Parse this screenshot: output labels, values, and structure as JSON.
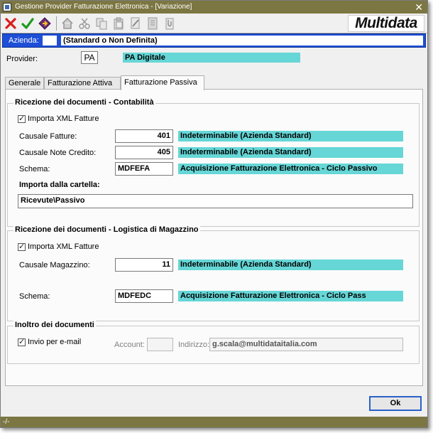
{
  "window": {
    "title": "Gestione Provider Fatturazione Elettronica - [Variazione]",
    "close_glyph": "✕"
  },
  "toolbar": {
    "logo_text": "Multidata",
    "buttons": [
      {
        "name": "cancel-icon"
      },
      {
        "name": "confirm-icon"
      },
      {
        "name": "run-icon"
      },
      {
        "name": "home-icon"
      },
      {
        "name": "cut-icon"
      },
      {
        "name": "copy-icon"
      },
      {
        "name": "paste-icon"
      },
      {
        "name": "edit-icon"
      },
      {
        "name": "document-icon"
      },
      {
        "name": "attach-icon"
      }
    ]
  },
  "azienda": {
    "label": "Azienda:",
    "code": "",
    "description": "(Standard o Non Definita)"
  },
  "provider": {
    "label": "Provider:",
    "code": "PA",
    "description": "PA Digitale"
  },
  "tabs": [
    {
      "label": "Generale",
      "active": false
    },
    {
      "label": "Fatturazione Attiva",
      "active": false
    },
    {
      "label": "Fatturazione Passiva",
      "active": true
    }
  ],
  "ricezione_contabilita": {
    "legend": "Ricezione dei documenti - Contabilità",
    "importa_xml_label": "Importa XML Fatture",
    "importa_xml_checked": true,
    "causale_fatture_label": "Causale Fatture:",
    "causale_fatture_code": "401",
    "causale_fatture_desc": "Indeterminabile (Azienda Standard)",
    "causale_note_label": "Causale Note Credito:",
    "causale_note_code": "405",
    "causale_note_desc": "Indeterminabile (Azienda Standard)",
    "schema_label": "Schema:",
    "schema_code": "MDFEFA",
    "schema_desc": "Acquisizione Fatturazione Elettronica - Ciclo Passivo",
    "cartella_label": "Importa dalla cartella:",
    "cartella_value": "Ricevute\\Passivo"
  },
  "ricezione_magazzino": {
    "legend": "Ricezione dei documenti - Logistica di Magazzino",
    "importa_xml_label": "Importa XML Fatture",
    "importa_xml_checked": true,
    "causale_label": "Causale Magazzino:",
    "causale_code": "11",
    "causale_desc": "Indeterminabile (Azienda Standard)",
    "schema_label": "Schema:",
    "schema_code": "MDFEDC",
    "schema_desc": "Acquisizione Fatturazione Elettronica - Ciclo Pass"
  },
  "inoltro": {
    "legend": "Inoltro dei documenti",
    "email_label": "Invio per e-mail",
    "email_checked": true,
    "account_label": "Account:",
    "account_value": "",
    "indirizzo_label": "Indirizzo:",
    "indirizzo_value": "g.scala@multidataitalia.com"
  },
  "footer": {
    "ok_label": "Ok",
    "status_text": "-/-"
  },
  "colors": {
    "titlebar": "#7c7642",
    "azienda_bar": "#1e4fd6",
    "lookup_fill": "#66d6d6"
  }
}
